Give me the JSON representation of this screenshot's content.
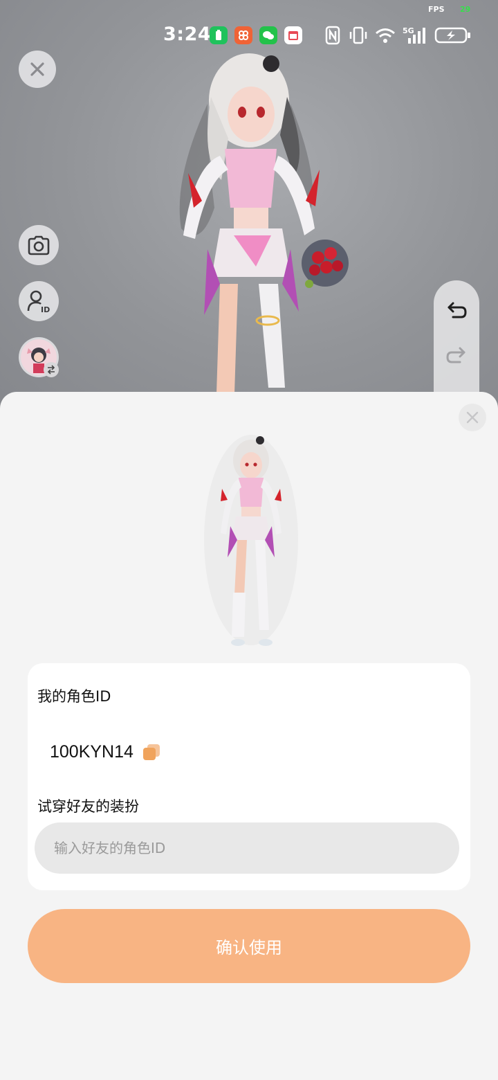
{
  "status_bar": {
    "fps_label": "FPS",
    "fps_value": "29",
    "time": "3:24",
    "network": "5G"
  },
  "scene": {
    "character": "3d-avatar"
  },
  "side_tools": {
    "close": "close-icon",
    "camera": "camera-icon",
    "id_card": "user-id-icon",
    "switch_avatar": "switch-icon",
    "undo": "undo-icon",
    "redo": "redo-icon"
  },
  "sheet": {
    "my_role_id_label": "我的角色ID",
    "my_role_id": "100KYN14",
    "try_on_label": "试穿好友的装扮",
    "friend_id_placeholder": "输入好友的角色ID",
    "friend_id_value": "",
    "confirm_label": "确认使用"
  },
  "colors": {
    "accent": "#f8b483",
    "copy_icon": "#f0a35c",
    "sheet_bg": "#f4f4f4",
    "input_bg": "#e8e8e8"
  }
}
